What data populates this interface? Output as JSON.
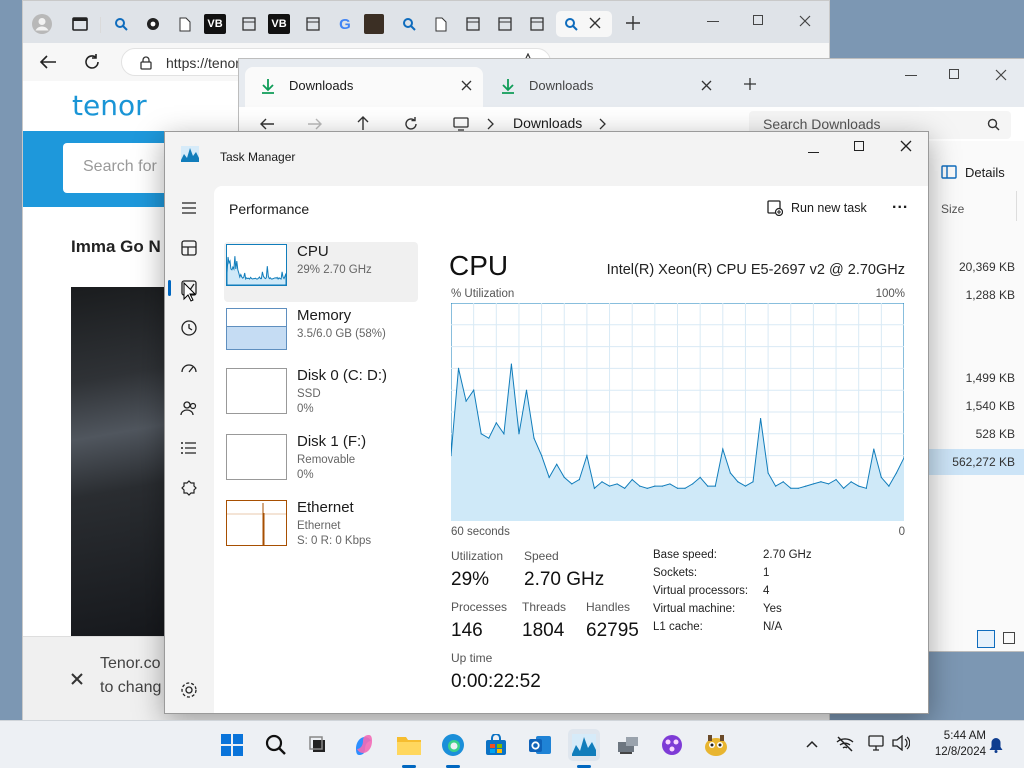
{
  "browser": {
    "url": "https://tenor.com/view/mission-go-now-spring-hobo",
    "logo": "tenor",
    "search_placeholder": "Search for",
    "gif_title": "Imma Go N",
    "cookie_text_1": "Tenor.co",
    "cookie_text_2": "to chang",
    "tabs": [
      "profile",
      "tab-actions",
      "search",
      "settings",
      "document",
      "VB",
      "window",
      "VB",
      "window",
      "google",
      "terminal",
      "search",
      "document",
      "window",
      "window",
      "window",
      "window",
      "search"
    ],
    "close_icon": "close-icon",
    "new_tab_icon": "plus-icon"
  },
  "explorer": {
    "tab1": "Downloads",
    "tab2": "Downloads",
    "path": "Downloads",
    "search_placeholder": "Search Downloads",
    "details_label": "Details",
    "size_header": "Size",
    "sizes": [
      "20,369 KB",
      "1,288 KB",
      "1,499 KB",
      "1,540 KB",
      "528 KB",
      "562,272 KB"
    ]
  },
  "taskmanager": {
    "title": "Task Manager",
    "page_title": "Performance",
    "run_new_task": "Run new task",
    "more_label": "...",
    "resources": [
      {
        "name": "CPU",
        "sub1": "29%  2.70 GHz",
        "sub2": "",
        "sub3": ""
      },
      {
        "name": "Memory",
        "sub1": "3.5/6.0 GB (58%)",
        "sub2": "",
        "sub3": ""
      },
      {
        "name": "Disk 0 (C: D:)",
        "sub1": "SSD",
        "sub2": "0%",
        "sub3": ""
      },
      {
        "name": "Disk 1 (F:)",
        "sub1": "Removable",
        "sub2": "0%",
        "sub3": ""
      },
      {
        "name": "Ethernet",
        "sub1": "Ethernet",
        "sub2": "S: 0  R: 0 Kbps",
        "sub3": ""
      }
    ],
    "cpu": {
      "heading": "CPU",
      "model": "Intel(R) Xeon(R) CPU E5-2697 v2 @ 2.70GHz",
      "y_label": "% Utilization",
      "y_max_label": "100%",
      "x_left_label": "60 seconds",
      "x_right_label": "0"
    },
    "stats": {
      "utilization_label": "Utilization",
      "utilization": "29%",
      "speed_label": "Speed",
      "speed": "2.70 GHz",
      "processes_label": "Processes",
      "processes": "146",
      "threads_label": "Threads",
      "threads": "1804",
      "handles_label": "Handles",
      "handles": "62795",
      "uptime_label": "Up time",
      "uptime": "0:00:22:52"
    },
    "specs": [
      {
        "k": "Base speed:",
        "v": "2.70 GHz"
      },
      {
        "k": "Sockets:",
        "v": "1"
      },
      {
        "k": "Virtual processors:",
        "v": "4"
      },
      {
        "k": "Virtual machine:",
        "v": "Yes"
      },
      {
        "k": "L1 cache:",
        "v": "N/A"
      }
    ]
  },
  "taskbar": {
    "time": "5:44 AM",
    "date": "12/8/2024"
  },
  "colors": {
    "accent": "#0067c0",
    "cpu_line": "#117dbb",
    "cpu_fill": "#cfe9f8",
    "mem_fill": "#c5dcf3",
    "eth_line": "#a74f01",
    "tenor_blue": "#1e98db"
  },
  "chart_data": {
    "type": "area",
    "title": "CPU",
    "xlabel": "60 seconds",
    "ylabel": "% Utilization",
    "xlim": [
      60,
      0
    ],
    "ylim": [
      0,
      100
    ],
    "grid": true,
    "x": [
      60,
      59,
      58,
      57,
      56,
      55,
      54,
      53,
      52,
      51,
      50,
      49,
      48,
      47,
      46,
      45,
      44,
      43,
      42,
      41,
      40,
      39,
      38,
      37,
      36,
      35,
      34,
      33,
      32,
      31,
      30,
      29,
      28,
      27,
      26,
      25,
      24,
      23,
      22,
      21,
      20,
      19,
      18,
      17,
      16,
      15,
      14,
      13,
      12,
      11,
      10,
      9,
      8,
      7,
      6,
      5,
      4,
      3,
      2,
      1,
      0
    ],
    "series": [
      {
        "values": [
          30,
          70,
          55,
          60,
          40,
          38,
          45,
          40,
          72,
          40,
          60,
          38,
          30,
          20,
          26,
          20,
          17,
          19,
          30,
          15,
          18,
          16,
          17,
          15,
          19,
          16,
          15,
          16,
          16,
          17,
          15,
          15,
          17,
          20,
          16,
          16,
          33,
          22,
          18,
          16,
          18,
          47,
          22,
          16,
          18,
          15,
          15,
          16,
          17,
          18,
          17,
          19,
          15,
          18,
          16,
          15,
          33,
          20,
          16,
          22,
          29
        ]
      }
    ]
  }
}
